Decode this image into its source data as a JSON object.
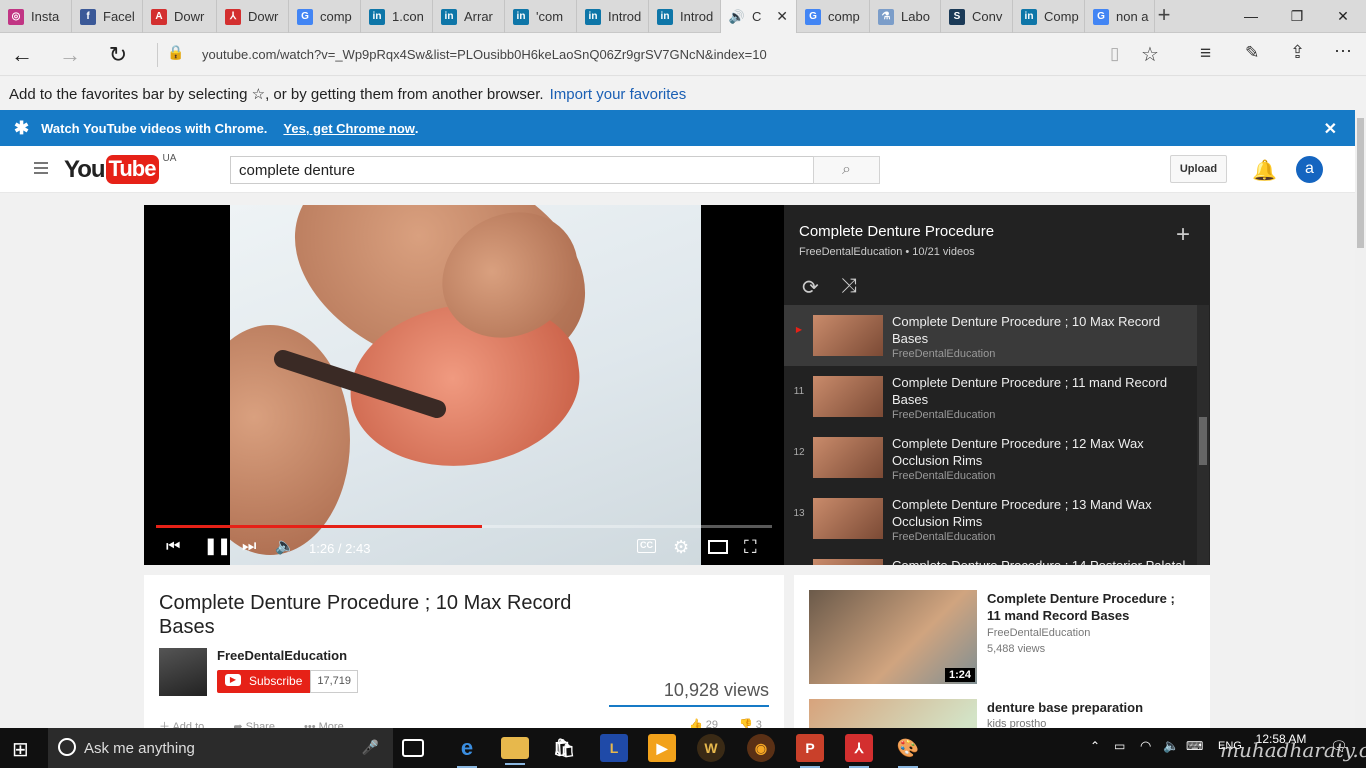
{
  "tabs": [
    {
      "label": "Insta",
      "icon": "instagram-icon",
      "color": "#c13584",
      "glyph": "◎"
    },
    {
      "label": "Facel",
      "icon": "facebook-icon",
      "color": "#3b5998",
      "glyph": "f"
    },
    {
      "label": "Dowr",
      "icon": "acrobat-icon",
      "color": "#d32f2f",
      "glyph": "A"
    },
    {
      "label": "Dowr",
      "icon": "pdf-icon",
      "color": "#d32f2f",
      "glyph": "⅄"
    },
    {
      "label": "comp",
      "icon": "google-icon",
      "color": "#4285f4",
      "glyph": "G"
    },
    {
      "label": "1.con",
      "icon": "linkedin-icon",
      "color": "#0e76a8",
      "glyph": "in"
    },
    {
      "label": "Arrar",
      "icon": "linkedin-icon",
      "color": "#0e76a8",
      "glyph": "in"
    },
    {
      "label": "'com",
      "icon": "linkedin-icon",
      "color": "#0e76a8",
      "glyph": "in"
    },
    {
      "label": "Introd",
      "icon": "linkedin-icon",
      "color": "#0e76a8",
      "glyph": "in"
    },
    {
      "label": "Introd",
      "icon": "linkedin-icon",
      "color": "#0e76a8",
      "glyph": "in"
    },
    {
      "label": "C",
      "icon": "speaker-icon",
      "color": "#f2f2f2",
      "glyph": "🔊",
      "active": true
    },
    {
      "label": "comp",
      "icon": "google-icon",
      "color": "#4285f4",
      "glyph": "G"
    },
    {
      "label": "Labo",
      "icon": "lab-icon",
      "color": "#7b9dc9",
      "glyph": "⚗"
    },
    {
      "label": "Conv",
      "icon": "s-icon",
      "color": "#1b3a57",
      "glyph": "S"
    },
    {
      "label": "Comp",
      "icon": "linkedin-icon",
      "color": "#0e76a8",
      "glyph": "in"
    },
    {
      "label": "non a",
      "icon": "google-icon",
      "color": "#4285f4",
      "glyph": "G"
    }
  ],
  "address": {
    "url": "youtube.com/watch?v=_Wp9pRqx4Sw&list=PLOusibb0H6keLaoSnQ06Zr9grSV7GNcN&index=10"
  },
  "favbar": {
    "text": "Add to the favorites bar by selecting ☆, or by getting them from another browser.",
    "link": "Import your favorites"
  },
  "promo": {
    "text": "Watch YouTube videos with Chrome.",
    "link": "Yes, get Chrome now",
    "period": "."
  },
  "masthead": {
    "logo_you": "You",
    "logo_tube": "Tube",
    "region": "UA",
    "search_value": "complete denture",
    "upload": "Upload",
    "avatar": "a"
  },
  "player": {
    "time": "1:26 / 2:43",
    "progress": 0.53,
    "cc": "CC"
  },
  "playlist": {
    "title": "Complete Denture Procedure",
    "subtitle": "FreeDentalEducation • 10/21 videos",
    "items": [
      {
        "num": "▶",
        "title": "Complete Denture Procedure ; 10 Max Record Bases",
        "channel": "FreeDentalEducation",
        "current": true
      },
      {
        "num": "11",
        "title": "Complete Denture Procedure ; 11 mand Record Bases",
        "channel": "FreeDentalEducation"
      },
      {
        "num": "12",
        "title": "Complete Denture Procedure ; 12 Max Wax Occlusion Rims",
        "channel": "FreeDentalEducation"
      },
      {
        "num": "13",
        "title": "Complete Denture Procedure ; 13 Mand Wax Occlusion Rims",
        "channel": "FreeDentalEducation"
      },
      {
        "num": "",
        "title": "Complete Denture Procedure ; 14 Posterior Palatal",
        "channel": ""
      }
    ]
  },
  "video": {
    "title": "Complete Denture Procedure ; 10 Max Record Bases",
    "channel": "FreeDentalEducation",
    "subscribe": "Subscribe",
    "subscribers": "17,719",
    "views": "10,928 views",
    "add_to": "Add to",
    "share": "Share",
    "more": "More",
    "likes": "29",
    "dislikes": "3"
  },
  "related": [
    {
      "title": "Complete Denture Procedure ; 11 mand Record Bases",
      "channel": "FreeDentalEducation",
      "views": "5,488 views",
      "duration": "1:24"
    },
    {
      "title": "denture base preparation",
      "channel": "kids prostho",
      "views": "",
      "duration": ""
    }
  ],
  "taskbar": {
    "search": "Ask me anything",
    "lang": "ENG",
    "time": "12:58 AM",
    "watermark": "muhadharaty.com"
  }
}
